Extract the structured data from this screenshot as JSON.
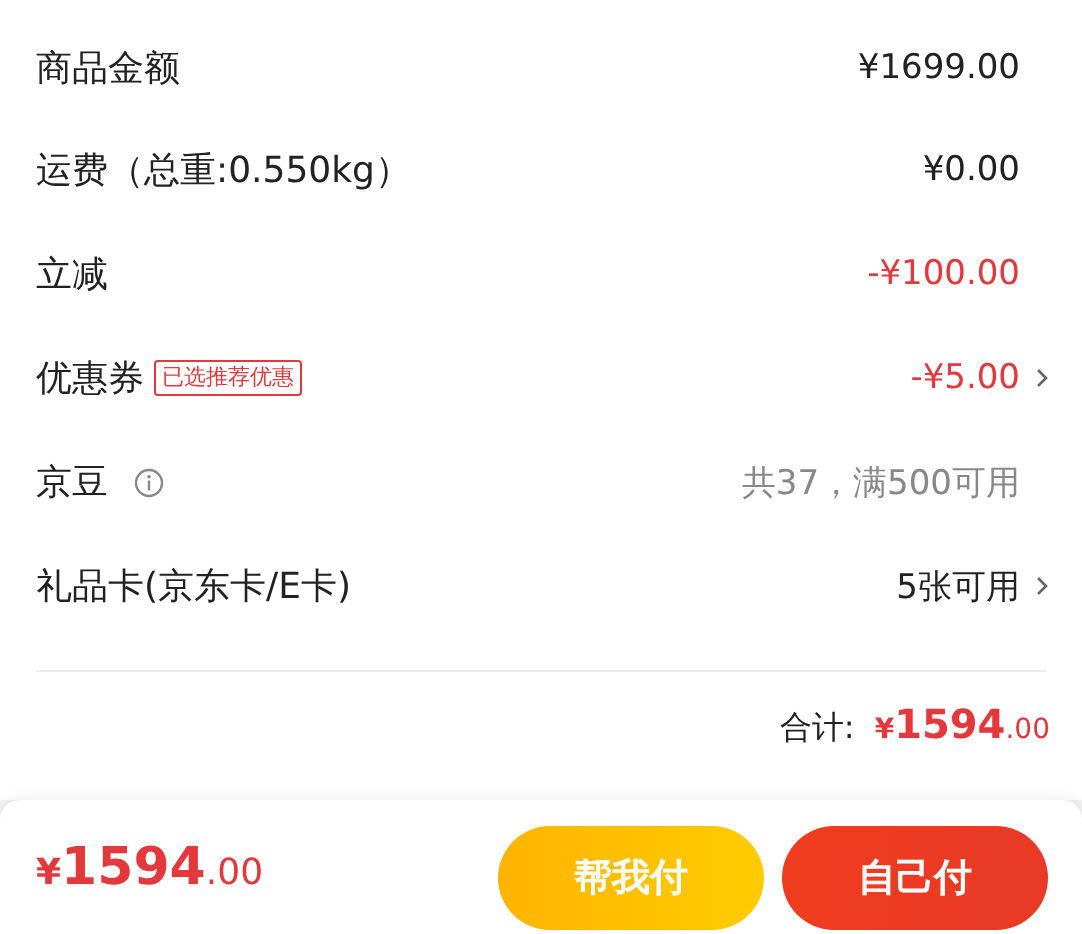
{
  "rows": [
    {
      "kind": "plain",
      "label": "商品金额",
      "value": "¥1699.00",
      "color": "#222222",
      "chevron": false
    },
    {
      "kind": "plain",
      "label": "运费（总重:0.550kg）",
      "value": "¥0.00",
      "color": "#222222",
      "chevron": false
    },
    {
      "kind": "plain",
      "label": "立减",
      "value": "-¥100.00",
      "color": "#e4393c",
      "chevron": false
    },
    {
      "kind": "tag",
      "label": "优惠券",
      "tag": "已选推荐优惠",
      "value": "-¥5.00",
      "color": "#e4393c",
      "chevron": true
    },
    {
      "kind": "info",
      "label": "京豆",
      "value": "共37，满500可用",
      "color": "#888888",
      "chevron": false
    },
    {
      "kind": "plain",
      "label": "礼品卡(京东卡/E卡)",
      "value": "5张可用",
      "color": "#222222",
      "chevron": true
    }
  ],
  "total": {
    "label": "合计:",
    "currency": "¥",
    "integer": "1594",
    "decimal": ".00"
  },
  "bottom_bar": {
    "currency": "¥",
    "integer": "1594",
    "decimal": ".00",
    "buttons": [
      {
        "label": "帮我付",
        "kind": "yellow"
      },
      {
        "label": "自己付",
        "kind": "red"
      }
    ]
  }
}
